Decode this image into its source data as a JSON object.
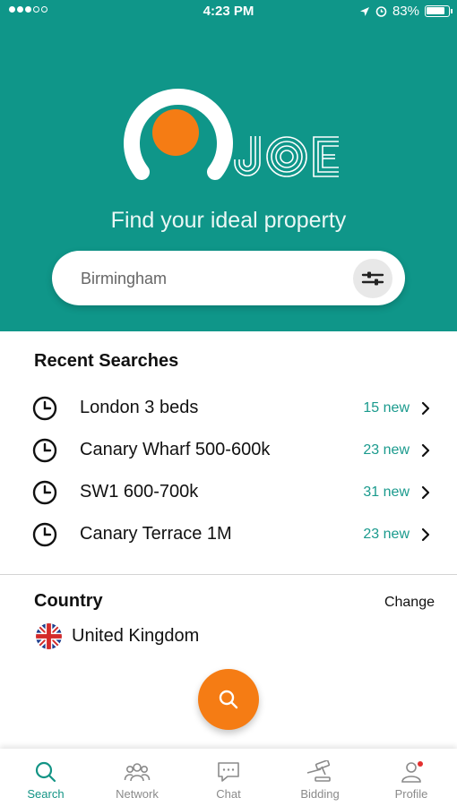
{
  "status_bar": {
    "time": "4:23 PM",
    "battery": "83%"
  },
  "brand": {
    "name": "JOE",
    "tagline": "Find your ideal property",
    "accent_color": "#0f9689",
    "orange": "#f57c14"
  },
  "search": {
    "placeholder": "Birmingham"
  },
  "recent": {
    "title": "Recent Searches",
    "items": [
      {
        "label": "London 3 beds",
        "count": "15 new"
      },
      {
        "label": "Canary Wharf 500-600k",
        "count": "23 new"
      },
      {
        "label": "SW1 600-700k",
        "count": "31 new"
      },
      {
        "label": "Canary Terrace 1M",
        "count": "23 new"
      }
    ]
  },
  "country": {
    "title": "Country",
    "change": "Change",
    "name": "United Kingdom",
    "flag_icon": "uk-flag-icon"
  },
  "tabs": [
    {
      "label": "Search",
      "icon": "search-icon",
      "active": true
    },
    {
      "label": "Network",
      "icon": "people-icon",
      "active": false
    },
    {
      "label": "Chat",
      "icon": "chat-icon",
      "active": false
    },
    {
      "label": "Bidding",
      "icon": "gavel-icon",
      "active": false
    },
    {
      "label": "Profile",
      "icon": "user-icon",
      "active": false,
      "notification": true
    }
  ]
}
